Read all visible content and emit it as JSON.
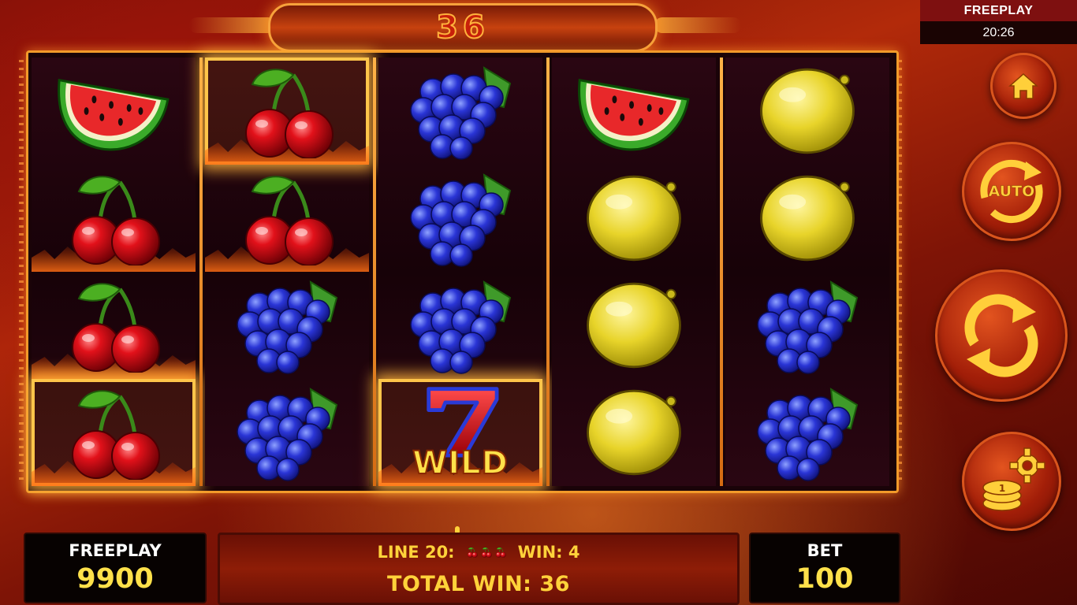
{
  "top_banner": {
    "win_amount": "36"
  },
  "clock": {
    "title": "FREEPLAY",
    "time": "20:26"
  },
  "reels": [
    [
      "watermelon",
      "cherry",
      "cherry",
      "cherry"
    ],
    [
      "cherry",
      "cherry",
      "grapes",
      "grapes"
    ],
    [
      "grapes",
      "grapes",
      "grapes",
      "wild-seven"
    ],
    [
      "watermelon",
      "lemon",
      "lemon",
      "lemon"
    ],
    [
      "lemon",
      "lemon",
      "grapes",
      "grapes"
    ]
  ],
  "winning_cells": [
    [
      0,
      3
    ],
    [
      1,
      0
    ],
    [
      2,
      3
    ]
  ],
  "wild": {
    "label": "WILD"
  },
  "buttons": {
    "home": "home-icon",
    "auto": "AUTO",
    "spin": "spin-icon",
    "settings": "coin-settings-icon"
  },
  "footer": {
    "freeplay_label": "FREEPLAY",
    "freeplay_value": "9900",
    "line_label": "LINE 20:",
    "win_label": "WIN: 4",
    "total_win": "TOTAL WIN: 36",
    "bet_label": "BET",
    "bet_value": "100"
  },
  "colors": {
    "accent": "#ffd23a",
    "frame": "#f29a2a",
    "banner_text": "#c8200a"
  }
}
